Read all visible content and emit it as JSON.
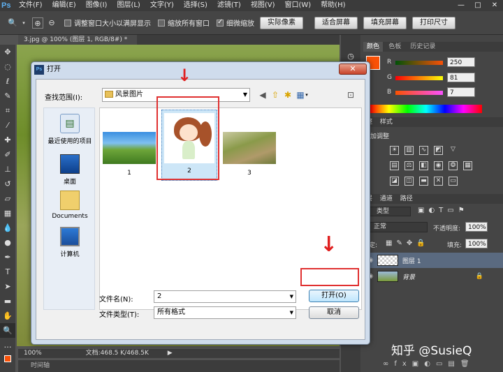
{
  "app": {
    "logo": "Ps"
  },
  "menu": [
    "文件(F)",
    "编辑(E)",
    "图像(I)",
    "图层(L)",
    "文字(Y)",
    "选择(S)",
    "滤镜(T)",
    "视图(V)",
    "窗口(W)",
    "帮助(H)"
  ],
  "window_controls": {
    "minimize": "—",
    "restore": "□",
    "close": "✕"
  },
  "options_bar": {
    "resize_windows": "调整窗口大小以满屏显示",
    "zoom_all": "缩放所有窗口",
    "scrubby_zoom": "细微缩放",
    "actual_pixels": "实际像素",
    "fit_screen": "适合屏幕",
    "fill_screen": "填充屏幕",
    "print_size": "打印尺寸"
  },
  "document_tab": "3.jpg @ 100% (图层 1, RGB/8#) *",
  "status_bar": {
    "zoom": "100%",
    "doc_info": "文档:468.5 K/468.5K"
  },
  "timeline": "时间轴",
  "color_panel": {
    "tabs": [
      "颜色",
      "色板",
      "历史记录"
    ],
    "r_label": "R",
    "g_label": "G",
    "b_label": "B",
    "r": "250",
    "g": "81",
    "b": "7",
    "fg_color": "#fa5107"
  },
  "adjustments_panel": {
    "tabs": [
      "整",
      "样式"
    ],
    "title": "加调整"
  },
  "layers_panel": {
    "tabs": [
      "层",
      "通道",
      "路径"
    ],
    "kind": "类型",
    "blend_mode": "正常",
    "opacity_label": "不透明度:",
    "opacity": "100%",
    "lock_label": "定:",
    "fill_label": "填充:",
    "fill": "100%",
    "layers": [
      {
        "name": "图层 1"
      },
      {
        "name": "背景"
      }
    ]
  },
  "dialog": {
    "title": "打开",
    "look_in_label": "查找范围(I):",
    "look_in_value": "风景图片",
    "places": [
      "最近使用的项目",
      "桌面",
      "Documents",
      "计算机"
    ],
    "files": [
      {
        "name": "1"
      },
      {
        "name": "2"
      },
      {
        "name": "3"
      }
    ],
    "filename_label": "文件名(N):",
    "filename_value": "2",
    "filetype_label": "文件类型(T):",
    "filetype_value": "所有格式",
    "open_button": "打开(O)",
    "cancel_button": "取消"
  },
  "watermark": "知乎 @SusieQ"
}
